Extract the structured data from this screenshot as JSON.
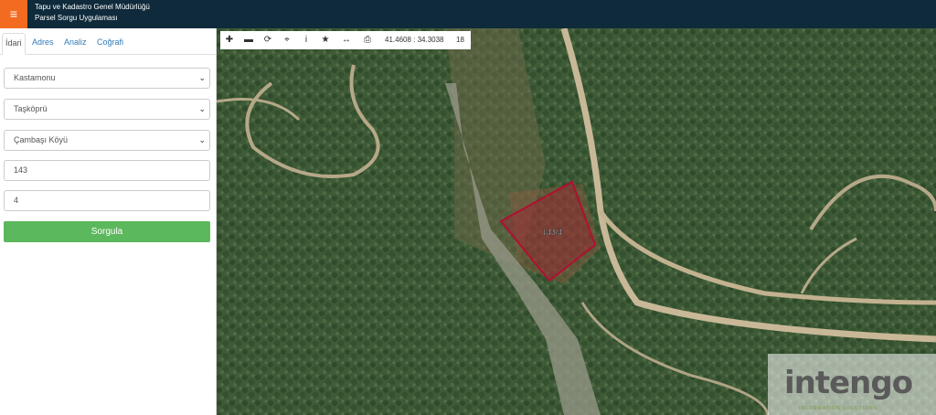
{
  "header": {
    "menu_icon": "≡",
    "title_line1": "Tapu ve Kadastro Genel Müdürlüğü",
    "title_line2": "Parsel Sorgu Uygulaması",
    "bar_color": "#0e2a3b",
    "menu_color": "#f26b21"
  },
  "sidebar": {
    "tabs": [
      {
        "label": "İdari",
        "active": true
      },
      {
        "label": "Adres"
      },
      {
        "label": "Analiz"
      },
      {
        "label": "Coğrafi"
      }
    ],
    "province": "Kastamonu",
    "district": "Taşköprü",
    "neighborhood": "Çambaşı Köyü",
    "block": "143",
    "parcel": "4",
    "query_button": "Sorgula",
    "button_color": "#5cb85c"
  },
  "map": {
    "toolbar": {
      "icons": [
        "plus-icon",
        "minus-icon",
        "refresh-icon",
        "crosshair-icon",
        "info-icon",
        "star-icon",
        "measure-icon",
        "print-icon"
      ],
      "coordinates": "41.4608 : 34.3038",
      "zoom": "18"
    },
    "parcel_label": "143/4",
    "parcel_color": "#b01030",
    "watermark_text": "intengo",
    "watermark_subtext": "INFORMATION SOLUTIONS"
  }
}
